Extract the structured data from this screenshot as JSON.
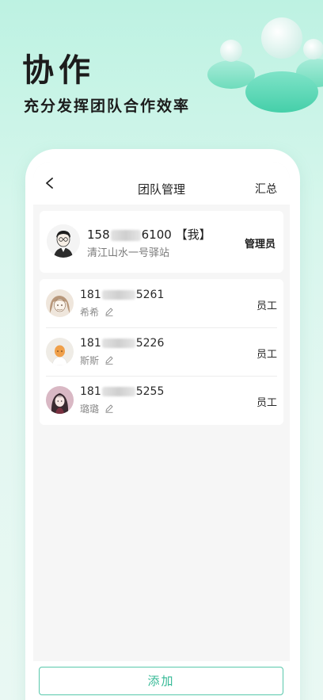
{
  "hero": {
    "title": "协作",
    "subtitle": "充分发挥团队合作效率"
  },
  "nav": {
    "back_icon": "chevron-left-icon",
    "title": "团队管理",
    "action_label": "汇总"
  },
  "admin": {
    "phone_prefix": "158",
    "phone_suffix": "6100",
    "me_tag": "【我】",
    "location": "清江山水一号驿站",
    "role": "管理员",
    "avatar_icon": "user-avatar-icon"
  },
  "members": [
    {
      "phone_prefix": "181",
      "phone_suffix": "5261",
      "name": "希希",
      "role": "员工"
    },
    {
      "phone_prefix": "181",
      "phone_suffix": "5226",
      "name": "斯斯",
      "role": "员工"
    },
    {
      "phone_prefix": "181",
      "phone_suffix": "5255",
      "name": "璐璐",
      "role": "员工"
    }
  ],
  "footer": {
    "add_label": "添加"
  },
  "colors": {
    "accent": "#35b996",
    "background_top": "#bdf2e2",
    "background_bottom": "#e9f8f3"
  }
}
